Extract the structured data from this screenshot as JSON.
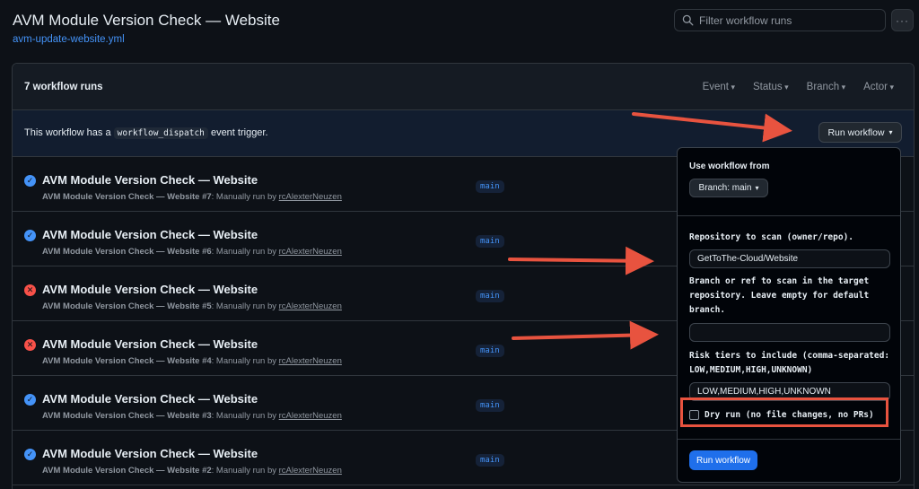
{
  "header": {
    "title": "AVM Module Version Check — Website",
    "workflow_file": "avm-update-website.yml",
    "filter_placeholder": "Filter workflow runs",
    "more_label": "···"
  },
  "runs_header": {
    "count_label": "7 workflow runs",
    "filters": [
      "Event",
      "Status",
      "Branch",
      "Actor"
    ]
  },
  "dispatch": {
    "text_before": "This workflow has a ",
    "code": "workflow_dispatch",
    "text_after": " event trigger.",
    "run_button": "Run workflow"
  },
  "runs": [
    {
      "title": "AVM Module Version Check — Website",
      "name": "AVM Module Version Check — Website",
      "num": "#7",
      "trigger": ": Manually run by ",
      "actor": "rcAlexterNeuzen",
      "branch": "main",
      "status": "success"
    },
    {
      "title": "AVM Module Version Check — Website",
      "name": "AVM Module Version Check — Website",
      "num": "#6",
      "trigger": ": Manually run by ",
      "actor": "rcAlexterNeuzen",
      "branch": "main",
      "status": "success"
    },
    {
      "title": "AVM Module Version Check — Website",
      "name": "AVM Module Version Check — Website",
      "num": "#5",
      "trigger": ": Manually run by ",
      "actor": "rcAlexterNeuzen",
      "branch": "main",
      "status": "failure"
    },
    {
      "title": "AVM Module Version Check — Website",
      "name": "AVM Module Version Check — Website",
      "num": "#4",
      "trigger": ": Manually run by ",
      "actor": "rcAlexterNeuzen",
      "branch": "main",
      "status": "failure"
    },
    {
      "title": "AVM Module Version Check — Website",
      "name": "AVM Module Version Check — Website",
      "num": "#3",
      "trigger": ": Manually run by ",
      "actor": "rcAlexterNeuzen",
      "branch": "main",
      "status": "success"
    },
    {
      "title": "AVM Module Version Check — Website",
      "name": "AVM Module Version Check — Website",
      "num": "#2",
      "trigger": ": Manually run by ",
      "actor": "rcAlexterNeuzen",
      "branch": "main",
      "status": "success"
    }
  ],
  "dropdown": {
    "use_from_label": "Use workflow from",
    "branch_button": "Branch: main",
    "repo_label": "Repository to scan (owner/repo).",
    "repo_value": "GetToThe-Cloud/Website",
    "ref_label": "Branch or ref to scan in the target repository. Leave empty for default branch.",
    "ref_value": "",
    "tiers_label": "Risk tiers to include (comma-separated: LOW,MEDIUM,HIGH,UNKNOWN)",
    "tiers_value": "LOW,MEDIUM,HIGH,UNKNOWN",
    "dry_run_label": "Dry run (no file changes, no PRs)",
    "dry_run_checked": false,
    "submit_label": "Run workflow"
  },
  "colors": {
    "accent": "#4493f8",
    "success": "#4493f8",
    "failure": "#f85149",
    "annotation": "#e8533f",
    "primary_button": "#1f6feb"
  },
  "icons": {
    "search": "search-icon",
    "success": "check-circle-icon",
    "failure": "x-circle-icon"
  }
}
